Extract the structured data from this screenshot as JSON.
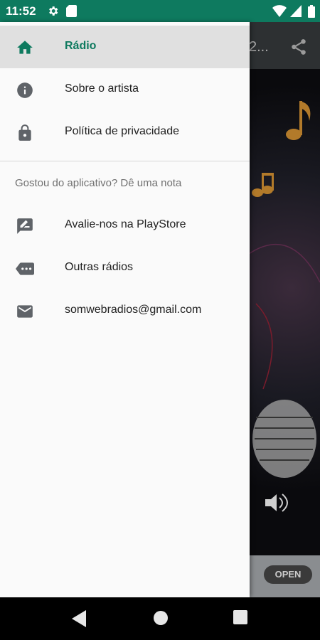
{
  "status_bar": {
    "time": "11:52",
    "icons": [
      "settings-icon",
      "sd-card-icon",
      "wifi-icon",
      "cellular-signal-icon",
      "battery-icon"
    ]
  },
  "background_app": {
    "toolbar_title": "2...",
    "ad_button": "OPEN"
  },
  "drawer": {
    "menu": [
      {
        "label": "Rádio",
        "icon": "home-icon",
        "active": true
      },
      {
        "label": "Sobre o artista",
        "icon": "info-icon"
      },
      {
        "label": "Política de privacidade",
        "icon": "lock-icon"
      }
    ],
    "section_title": "Gostou do aplicativo? Dê uma nota",
    "secondary": [
      {
        "label": "Avalie-nos na PlayStore",
        "icon": "rate-review-icon"
      },
      {
        "label": "Outras rádios",
        "icon": "more-label-icon"
      },
      {
        "label": "somwebradios@gmail.com",
        "icon": "email-icon"
      }
    ]
  },
  "colors": {
    "primary": "#0e7a5f",
    "drawer_bg": "#fafafa",
    "active_bg": "#e0e0e0"
  }
}
